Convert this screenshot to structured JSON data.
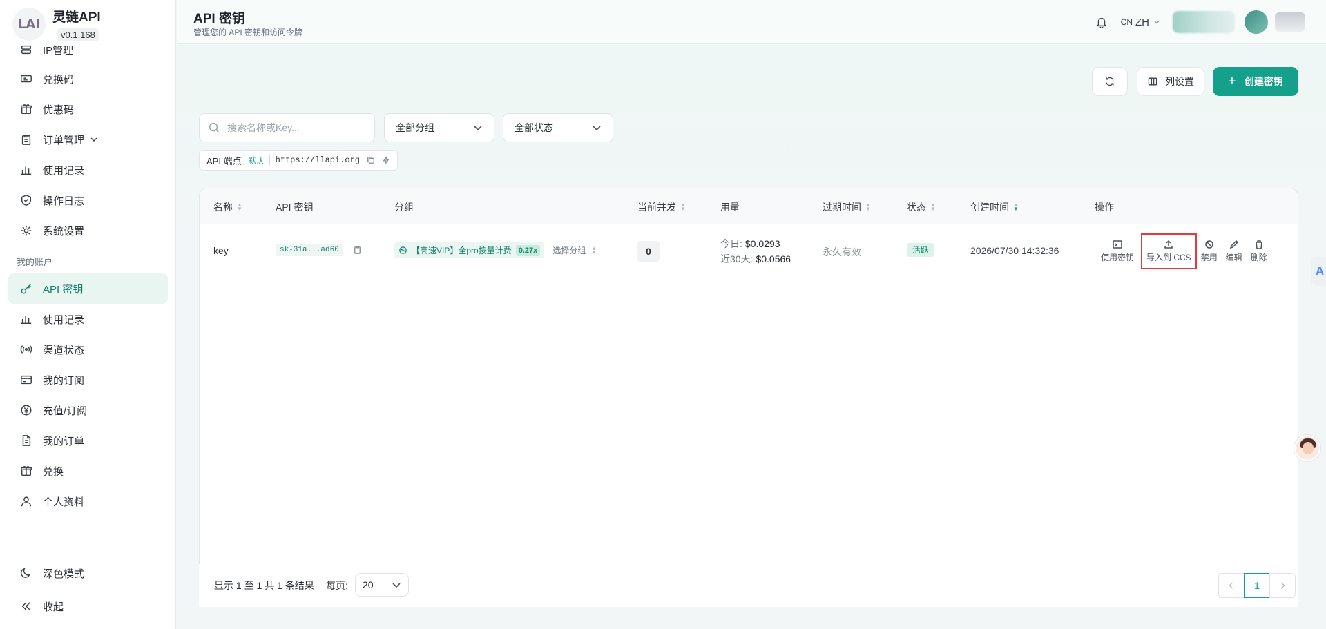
{
  "brand": {
    "logo_text": "LAI",
    "name": "灵链API",
    "version": "v0.1.168"
  },
  "sidebar": {
    "items_top": [
      {
        "label": "IP管理",
        "icon": "server-icon"
      },
      {
        "label": "兑换码",
        "icon": "ticket-icon"
      },
      {
        "label": "优惠码",
        "icon": "gift-icon"
      },
      {
        "label": "订单管理",
        "icon": "clipboard-icon"
      },
      {
        "label": "使用记录",
        "icon": "bar-chart-icon"
      },
      {
        "label": "操作日志",
        "icon": "shield-icon"
      },
      {
        "label": "系统设置",
        "icon": "gear-icon"
      }
    ],
    "section_label": "我的账户",
    "items_account": [
      {
        "label": "API 密钥",
        "icon": "key-icon",
        "active": true
      },
      {
        "label": "使用记录",
        "icon": "bar-chart-icon"
      },
      {
        "label": "渠道状态",
        "icon": "signal-icon"
      },
      {
        "label": "我的订阅",
        "icon": "card-icon"
      },
      {
        "label": "充值/订阅",
        "icon": "yen-icon"
      },
      {
        "label": "我的订单",
        "icon": "document-icon"
      },
      {
        "label": "兑换",
        "icon": "gift-icon"
      },
      {
        "label": "个人资料",
        "icon": "user-icon"
      }
    ],
    "dark_mode": "深色模式",
    "collapse": "收起"
  },
  "header": {
    "title": "API 密钥",
    "subtitle": "管理您的 API 密钥和访问令牌",
    "lang_flag": "CN",
    "lang": "ZH"
  },
  "toolbar": {
    "columns_label": "列设置",
    "create_label": "创建密钥"
  },
  "filters": {
    "search_placeholder": "搜索名称或Key...",
    "group_select": "全部分组",
    "status_select": "全部状态"
  },
  "endpoint": {
    "label": "API 端点",
    "tag": "默认",
    "url": "https://llapi.org"
  },
  "table": {
    "headers": [
      "名称",
      "API 密钥",
      "分组",
      "当前并发",
      "用量",
      "过期时间",
      "状态",
      "创建时间",
      "操作"
    ],
    "rows": [
      {
        "name": "key",
        "key": "sk-31a...ad60",
        "group": "【高速VIP】全pro按量计费",
        "multiplier": "0.27x",
        "select_group": "选择分组",
        "concurrency": "0",
        "usage_today_label": "今日:",
        "usage_today": "$0.0293",
        "usage_30d_label": "近30天:",
        "usage_30d": "$0.0566",
        "expiry": "永久有效",
        "status": "活跃",
        "created": "2026/07/30 14:32:36",
        "actions": [
          "使用密钥",
          "导入到 CCS",
          "禁用",
          "编辑",
          "删除"
        ]
      }
    ]
  },
  "pagination": {
    "info": "显示 1 至 1 共 1 条结果",
    "per_page_label": "每页:",
    "per_page": "20",
    "current_page": "1"
  },
  "colors": {
    "accent": "#14a08a",
    "highlight": "#e23b3b"
  }
}
